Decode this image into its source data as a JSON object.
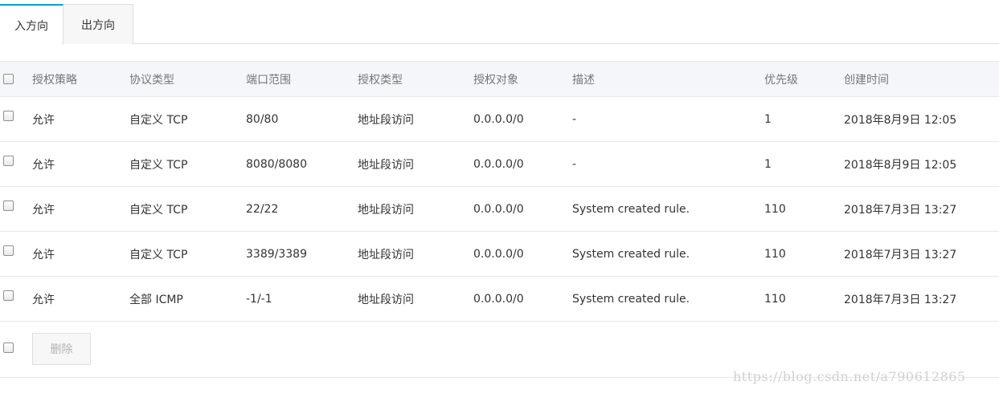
{
  "tabs": [
    {
      "label": "入方向",
      "active": true
    },
    {
      "label": "出方向",
      "active": false
    }
  ],
  "colors": {
    "accent": "#00a2ca",
    "header_bg": "#f5f6fa",
    "border": "#e6e7eb"
  },
  "table": {
    "headers": [
      "授权策略",
      "协议类型",
      "端口范围",
      "授权类型",
      "授权对象",
      "描述",
      "优先级",
      "创建时间"
    ],
    "rows": [
      [
        "允许",
        "自定义 TCP",
        "80/80",
        "地址段访问",
        "0.0.0.0/0",
        "-",
        "1",
        "2018年8月9日 12:05"
      ],
      [
        "允许",
        "自定义 TCP",
        "8080/8080",
        "地址段访问",
        "0.0.0.0/0",
        "-",
        "1",
        "2018年8月9日 12:05"
      ],
      [
        "允许",
        "自定义 TCP",
        "22/22",
        "地址段访问",
        "0.0.0.0/0",
        "System created rule.",
        "110",
        "2018年7月3日 13:27"
      ],
      [
        "允许",
        "自定义 TCP",
        "3389/3389",
        "地址段访问",
        "0.0.0.0/0",
        "System created rule.",
        "110",
        "2018年7月3日 13:27"
      ],
      [
        "允许",
        "全部 ICMP",
        "-1/-1",
        "地址段访问",
        "0.0.0.0/0",
        "System created rule.",
        "110",
        "2018年7月3日 13:27"
      ]
    ]
  },
  "footer": {
    "delete_label": "删除"
  },
  "watermark": "https://blog.csdn.net/a790612865"
}
